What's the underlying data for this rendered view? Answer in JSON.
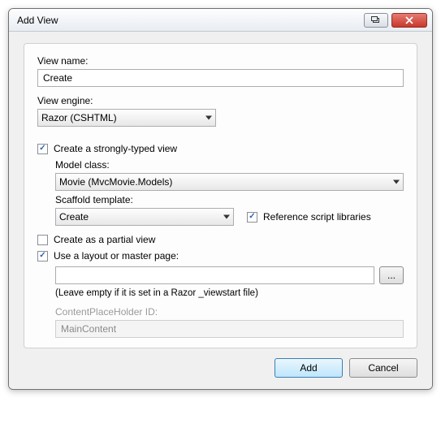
{
  "title": "Add View",
  "labels": {
    "viewName": "View name:",
    "viewEngine": "View engine:",
    "stronglyTyped": "Create a strongly-typed view",
    "modelClass": "Model class:",
    "scaffoldTemplate": "Scaffold template:",
    "refScript": "Reference script libraries",
    "partial": "Create as a partial view",
    "useLayout": "Use a layout or master page:",
    "layoutHint": "(Leave empty if it is set in a Razor _viewstart file)",
    "cphId": "ContentPlaceHolder ID:"
  },
  "values": {
    "viewName": "Create",
    "viewEngine": "Razor (CSHTML)",
    "modelClass": "Movie (MvcMovie.Models)",
    "scaffoldTemplate": "Create",
    "layoutPath": "",
    "cphId": "MainContent"
  },
  "checked": {
    "stronglyTyped": true,
    "refScript": true,
    "partial": false,
    "useLayout": true
  },
  "buttons": {
    "browse": "...",
    "add": "Add",
    "cancel": "Cancel"
  }
}
